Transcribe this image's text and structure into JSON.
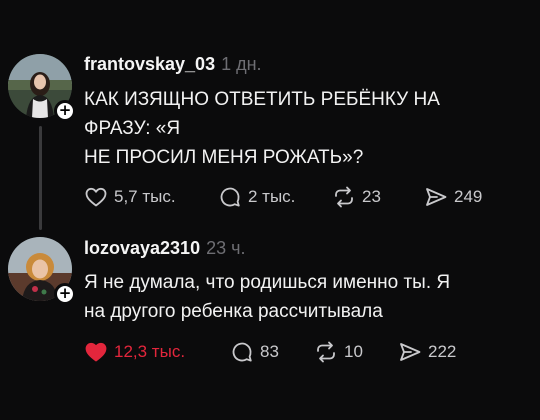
{
  "comments": [
    {
      "username": "frantovskay_03",
      "time": "1 дн.",
      "text_lines": [
        "КАК ИЗЯЩНО ОТВЕТИТЬ РЕБЁНКУ НА",
        "ФРАЗУ: «Я",
        "НЕ ПРОСИЛ МЕНЯ РОЖАТЬ»?"
      ],
      "likes": "5,7 тыс.",
      "replies": "2 тыс.",
      "reposts": "23",
      "shares": "249",
      "liked": false
    },
    {
      "username": "lozovaya2310",
      "time": "23 ч.",
      "text_lines": [
        "Я не думала, что родишься именно ты. Я",
        "на другого ребенка рассчитывала"
      ],
      "likes": "12,3 тыс.",
      "replies": "83",
      "reposts": "10",
      "shares": "222",
      "liked": true
    }
  ],
  "icons": {
    "like": "heart-icon",
    "reply": "comment-bubble-icon",
    "repost": "repost-icon",
    "share": "send-icon",
    "follow": "plus-icon"
  },
  "colors": {
    "background": "#0b0b0c",
    "liked": "#e3263c",
    "muted": "#6e6e73"
  }
}
